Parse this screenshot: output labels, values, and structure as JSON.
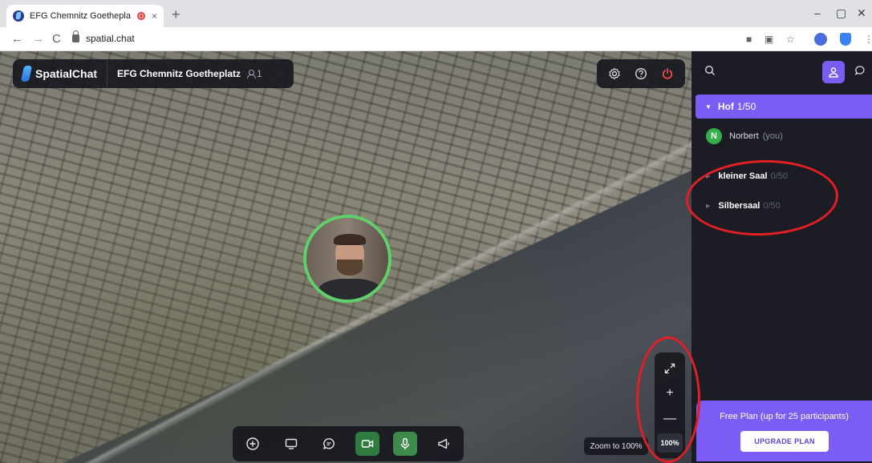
{
  "browser": {
    "tab_title": "EFG Chemnitz Goetheplatz /",
    "tab_close": "×",
    "new_tab": "+",
    "url": "spatial.chat",
    "window_controls": [
      "–",
      "▢",
      "✕"
    ]
  },
  "app": {
    "brand": "SpatialChat",
    "space_name": "EFG Chemnitz Goetheplatz",
    "people_count": "1",
    "top_icons": [
      "settings-icon",
      "help-icon",
      "power-icon"
    ]
  },
  "toolbar": {
    "buttons": [
      "add-icon",
      "screen-share-icon",
      "chat-bubble-icon",
      "camera-icon",
      "microphone-icon",
      "megaphone-icon"
    ]
  },
  "zoom": {
    "expand": "⤢",
    "plus": "+",
    "minus": "—",
    "percent": "100%",
    "tooltip": "Zoom to 100%"
  },
  "sidebar": {
    "active_room": {
      "name": "Hof",
      "count": "1/50"
    },
    "members": [
      {
        "initial": "N",
        "name": "Norbert",
        "suffix": "(you)"
      }
    ],
    "rooms": [
      {
        "name": "kleiner Saal",
        "count": "0/50"
      },
      {
        "name": "Silbersaal",
        "count": "0/50"
      }
    ],
    "plan": {
      "text": "Free Plan (up for 25 participants)",
      "button": "UPGRADE PLAN"
    }
  },
  "colors": {
    "accent": "#7b5cf5",
    "active_green": "#5fd06b",
    "annotation_red": "#e31e24"
  }
}
